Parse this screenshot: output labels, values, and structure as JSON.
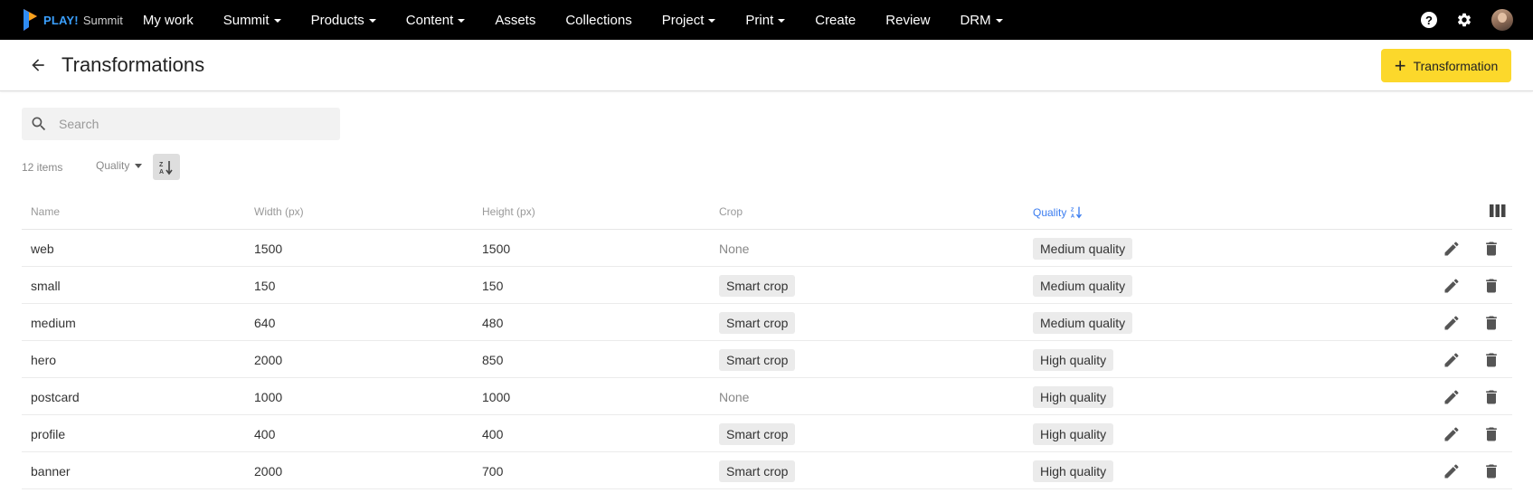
{
  "topnav": {
    "logo_play": "PLAY!",
    "logo_summit": "Summit",
    "items": [
      {
        "label": "My work",
        "dropdown": false
      },
      {
        "label": "Summit",
        "dropdown": true
      },
      {
        "label": "Products",
        "dropdown": true
      },
      {
        "label": "Content",
        "dropdown": true
      },
      {
        "label": "Assets",
        "dropdown": false
      },
      {
        "label": "Collections",
        "dropdown": false
      },
      {
        "label": "Project",
        "dropdown": true
      },
      {
        "label": "Print",
        "dropdown": true
      },
      {
        "label": "Create",
        "dropdown": false
      },
      {
        "label": "Review",
        "dropdown": false
      },
      {
        "label": "DRM",
        "dropdown": true
      }
    ],
    "help_glyph": "?"
  },
  "header": {
    "title": "Transformations",
    "add_button_label": "Transformation",
    "add_button_glyph": "+"
  },
  "search": {
    "placeholder": "Search",
    "value": ""
  },
  "toolbar": {
    "item_count": "12 items",
    "sort_field": "Quality",
    "sort_direction": "descending"
  },
  "table": {
    "columns": {
      "name": "Name",
      "width": "Width (px)",
      "height": "Height (px)",
      "crop": "Crop",
      "quality": "Quality"
    },
    "rows": [
      {
        "name": "web",
        "width": "1500",
        "height": "1500",
        "crop": "None",
        "quality": "Medium quality"
      },
      {
        "name": "small",
        "width": "150",
        "height": "150",
        "crop": "Smart crop",
        "quality": "Medium quality"
      },
      {
        "name": "medium",
        "width": "640",
        "height": "480",
        "crop": "Smart crop",
        "quality": "Medium quality"
      },
      {
        "name": "hero",
        "width": "2000",
        "height": "850",
        "crop": "Smart crop",
        "quality": "High quality"
      },
      {
        "name": "postcard",
        "width": "1000",
        "height": "1000",
        "crop": "None",
        "quality": "High quality"
      },
      {
        "name": "profile",
        "width": "400",
        "height": "400",
        "crop": "Smart crop",
        "quality": "High quality"
      },
      {
        "name": "banner",
        "width": "2000",
        "height": "700",
        "crop": "Smart crop",
        "quality": "High quality"
      }
    ]
  },
  "colors": {
    "nav_bg": "#000000",
    "accent_button": "#fcd82b",
    "active_sort": "#3b7df0",
    "chip_bg": "#ebebeb"
  }
}
